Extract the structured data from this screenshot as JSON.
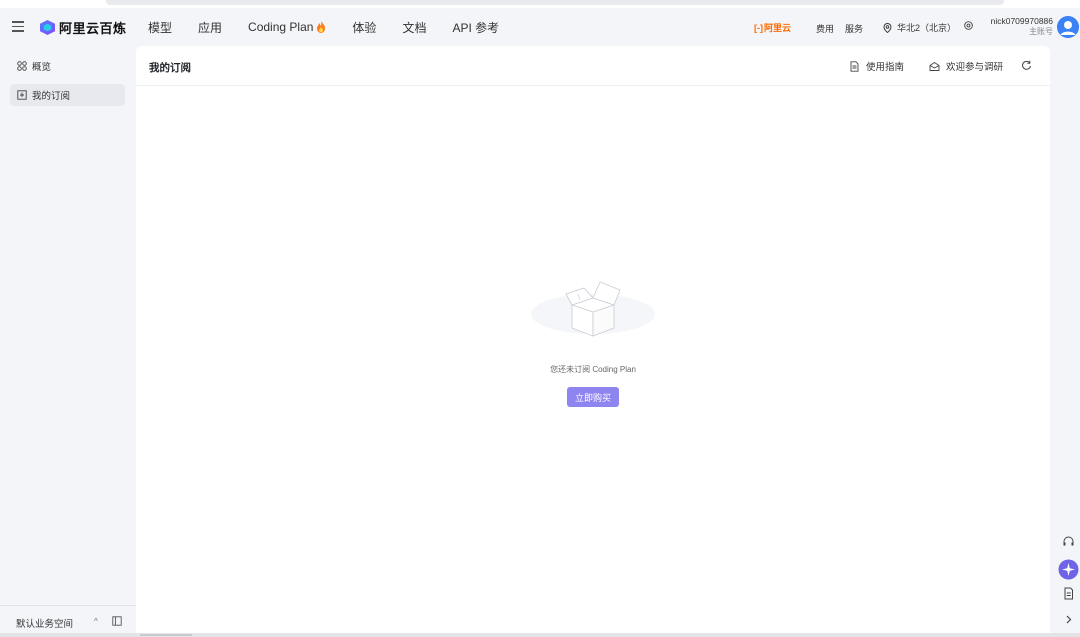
{
  "app": {
    "logo_text": "阿里云百炼",
    "brand_text": "阿里云"
  },
  "nav": {
    "items": [
      {
        "label": "模型"
      },
      {
        "label": "应用"
      },
      {
        "label": "Coding Plan"
      },
      {
        "label": "体验"
      },
      {
        "label": "文档"
      },
      {
        "label": "API 参考"
      }
    ]
  },
  "header": {
    "fees_label": "费用",
    "service_label": "服务",
    "region_label": "华北2（北京）",
    "username": "nick0709970886",
    "account_role": "主账号"
  },
  "sidebar": {
    "items": [
      {
        "label": "概览",
        "icon": "overview-icon",
        "active": false
      },
      {
        "label": "我的订阅",
        "icon": "subscription-icon",
        "active": true
      }
    ],
    "workspace_label": "默认业务空间"
  },
  "main": {
    "title": "我的订阅",
    "actions": {
      "guide_label": "使用指南",
      "survey_label": "欢迎参与调研"
    },
    "empty": {
      "message": "您还未订阅 Coding Plan",
      "button_label": "立即购买"
    }
  },
  "colors": {
    "accent_button": "#8f85f0",
    "brand_orange": "#ff6a00",
    "avatar_blue": "#3b82f6"
  }
}
